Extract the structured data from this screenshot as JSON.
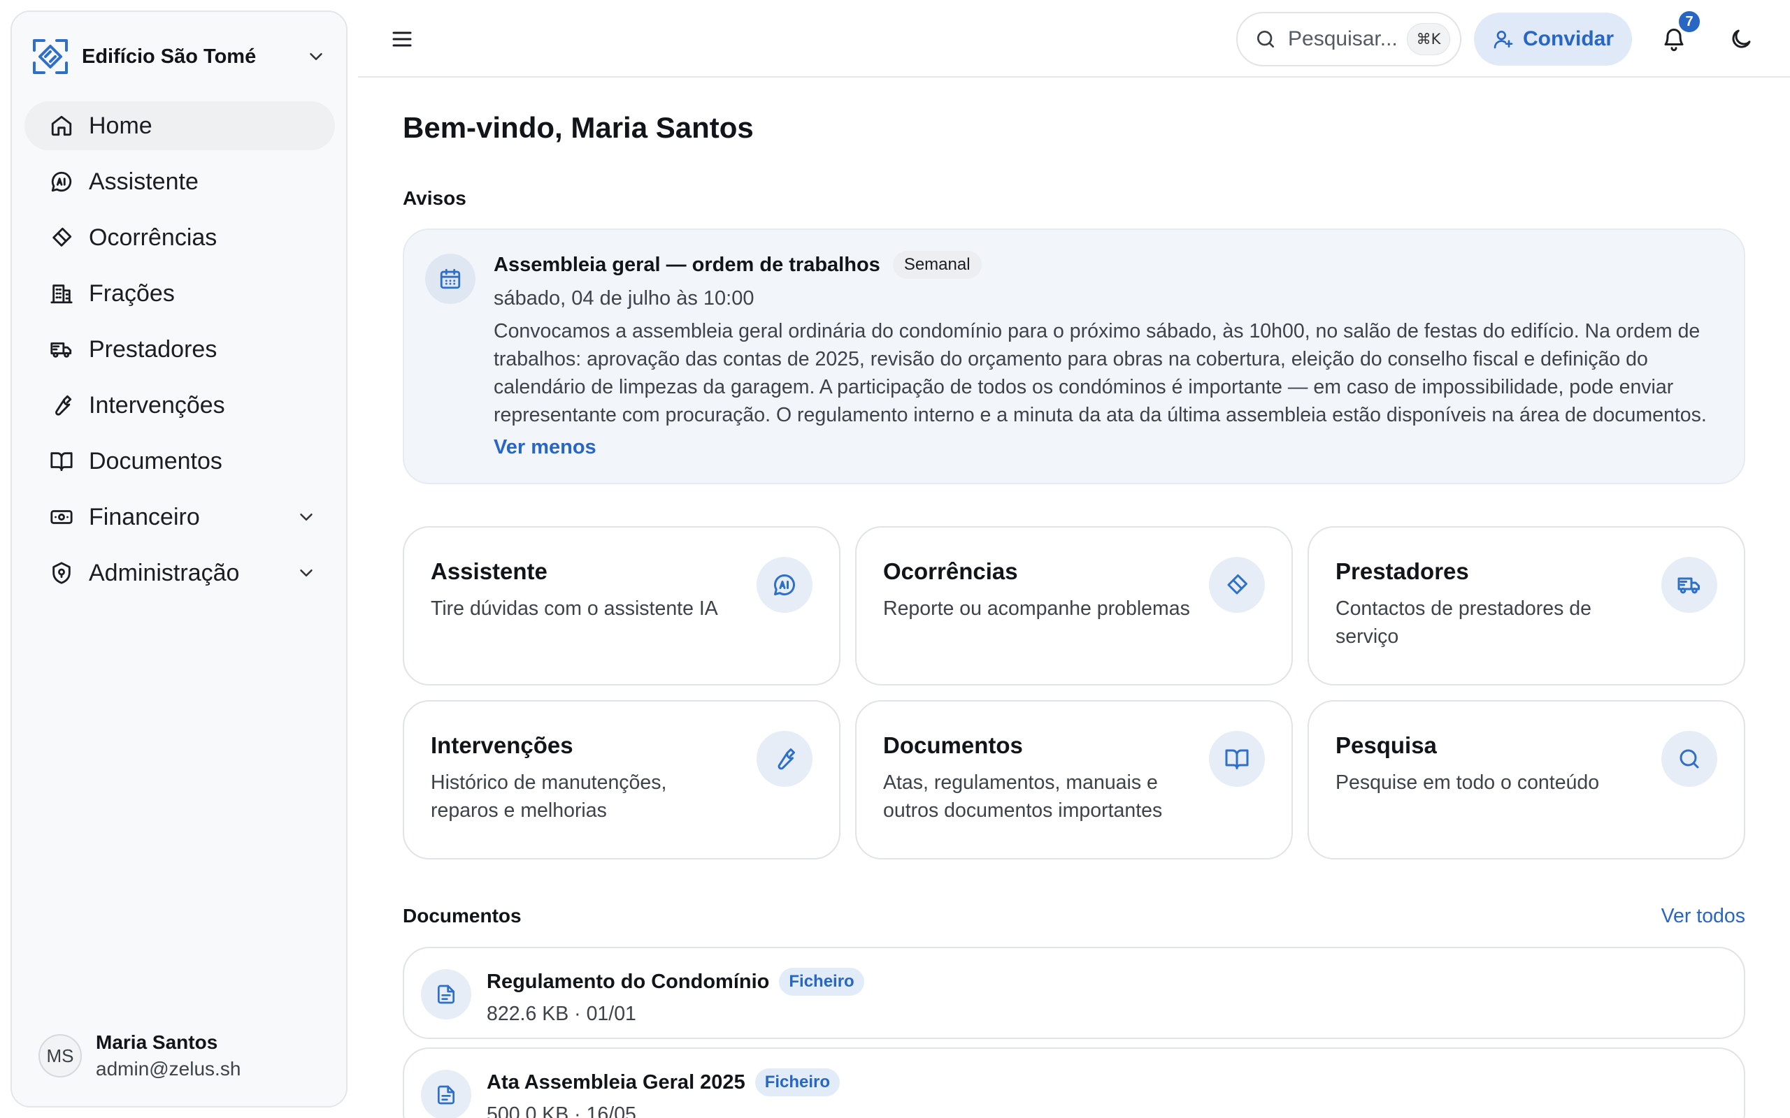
{
  "sidebar": {
    "org_name": "Edifício São Tomé",
    "items": [
      {
        "label": "Home",
        "icon": "home-icon"
      },
      {
        "label": "Assistente",
        "icon": "ai-chat-icon"
      },
      {
        "label": "Ocorrências",
        "icon": "eraser-icon"
      },
      {
        "label": "Frações",
        "icon": "building-icon"
      },
      {
        "label": "Prestadores",
        "icon": "truck-icon"
      },
      {
        "label": "Intervenções",
        "icon": "wrench-icon"
      },
      {
        "label": "Documentos",
        "icon": "book-icon"
      },
      {
        "label": "Financeiro",
        "icon": "banknote-icon"
      },
      {
        "label": "Administração",
        "icon": "shield-icon"
      }
    ],
    "user": {
      "initials": "MS",
      "name": "Maria Santos",
      "email": "admin@zelus.sh"
    }
  },
  "topbar": {
    "search_placeholder": "Pesquisar...",
    "search_shortcut": "⌘K",
    "invite_label": "Convidar",
    "notifications_count": "7"
  },
  "main": {
    "welcome": "Bem-vindo, Maria Santos",
    "notices_title": "Avisos",
    "notice": {
      "title": "Assembleia geral — ordem de trabalhos",
      "tag": "Semanal",
      "date": "sábado, 04 de julho às 10:00",
      "text": "Convocamos a assembleia geral ordinária do condomínio para o próximo sábado, às 10h00, no salão de festas do edifício. Na ordem de trabalhos: aprovação das contas de 2025, revisão do orçamento para obras na cobertura, eleição do conselho fiscal e definição do calendário de limpezas da garagem. A participação de todos os condóminos é importante — em caso de impossibilidade, pode enviar representante com procuração. O regulamento interno e a minuta da ata da última assembleia estão disponíveis na área de documentos.",
      "toggle": "Ver menos"
    },
    "cards": [
      {
        "title": "Assistente",
        "desc": "Tire dúvidas com o assistente IA",
        "icon": "ai-chat-icon"
      },
      {
        "title": "Ocorrências",
        "desc": "Reporte ou acompanhe problemas",
        "icon": "eraser-icon"
      },
      {
        "title": "Prestadores",
        "desc": "Contactos de prestadores de serviço",
        "icon": "truck-icon"
      },
      {
        "title": "Intervenções",
        "desc": "Histórico de manutenções, reparos e melhorias",
        "icon": "wrench-icon"
      },
      {
        "title": "Documentos",
        "desc": "Atas, regulamentos, manuais e outros documentos importantes",
        "icon": "book-icon"
      },
      {
        "title": "Pesquisa",
        "desc": "Pesquise em todo o conteúdo",
        "icon": "search-icon"
      }
    ],
    "documents_title": "Documentos",
    "documents_link": "Ver todos",
    "documents": [
      {
        "name": "Regulamento do Condomínio",
        "tag": "Ficheiro",
        "meta": "822.6 KB · 01/01"
      },
      {
        "name": "Ata Assembleia Geral 2025",
        "tag": "Ficheiro",
        "meta": "500.0 KB · 16/05"
      }
    ]
  },
  "colors": {
    "accent": "#2767c3",
    "accent_soft": "#dfe9f7",
    "notice_bg": "#f2f6fb"
  }
}
